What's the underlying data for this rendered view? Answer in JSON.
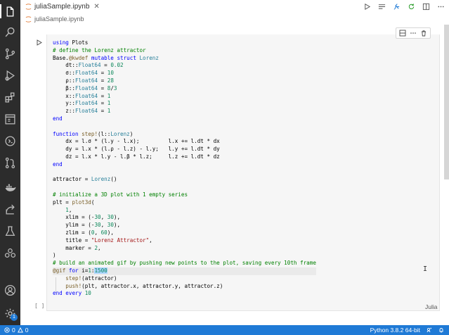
{
  "tab": {
    "title": "juliaSample.ipynb",
    "close": "✕"
  },
  "breadcrumb": {
    "file": "juliaSample.ipynb"
  },
  "cell": {
    "language": "Julia",
    "exec_count": "[ ]",
    "code_lines": [
      "using Plots",
      "# define the Lorenz attractor",
      "Base.@kwdef mutable struct Lorenz",
      "    dt::Float64 = 0.02",
      "    σ::Float64 = 10",
      "    ρ::Float64 = 28",
      "    β::Float64 = 8/3",
      "    x::Float64 = 1",
      "    y::Float64 = 1",
      "    z::Float64 = 1",
      "end",
      "",
      "function step!(l::Lorenz)",
      "    dx = l.σ * (l.y - l.x);         l.x += l.dt * dx",
      "    dy = l.x * (l.ρ - l.z) - l.y;   l.y += l.dt * dy",
      "    dz = l.x * l.y - l.β * l.z;     l.z += l.dt * dz",
      "end",
      "",
      "attractor = Lorenz()",
      "",
      "# initialize a 3D plot with 1 empty series",
      "plt = plot3d(",
      "    1,",
      "    xlim = (-30, 30),",
      "    ylim = (-30, 30),",
      "    zlim = (0, 60),",
      "    title = \"Lorenz Attractor\",",
      "    marker = 2,",
      ")",
      "# build an animated gif by pushing new points to the plot, saving every 10th frame",
      "@gif for i=1:1500",
      "    step!(attractor)",
      "    push!(plt, attractor.x, attractor.y, attractor.z)",
      "end every 10"
    ]
  },
  "status": {
    "errors": "0",
    "warnings": "0",
    "interpreter": "Python 3.8.2 64-bit"
  },
  "colors": {
    "activity_bar": "#2c2c2c",
    "status_bar": "#1f7ad6",
    "keyword": "#0000ff",
    "comment": "#008000",
    "number": "#098658",
    "type": "#267f99",
    "string": "#a31515"
  },
  "icons": {
    "activity": [
      "files-icon",
      "search-icon",
      "source-control-icon",
      "run-debug-icon",
      "extensions-icon",
      "browser-icon",
      "remote-icon",
      "pull-request-icon",
      "docker-icon",
      "live-share-icon",
      "testing-icon",
      "liveshare-group-icon",
      "account-icon",
      "settings-gear-icon"
    ],
    "editor_actions": [
      "run-all-icon",
      "clear-outputs-icon",
      "variables-icon",
      "restart-kernel-icon",
      "split-editor-icon",
      "more-actions-icon"
    ]
  }
}
